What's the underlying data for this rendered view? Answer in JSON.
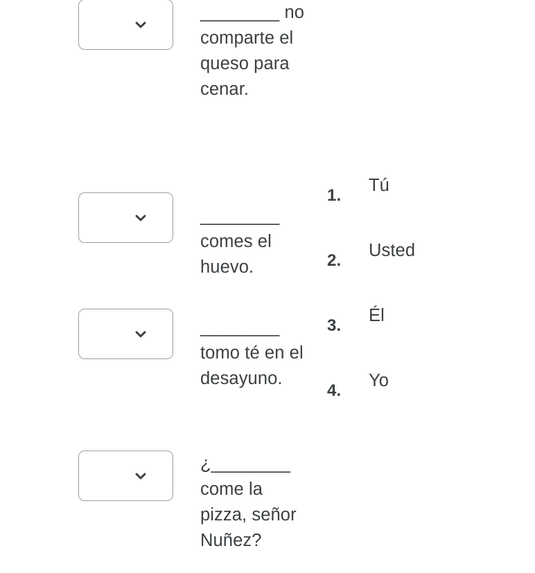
{
  "exercise": {
    "questions": [
      {
        "id": "q1",
        "select_name": "answer-select-1",
        "selected_value": "",
        "icon": "chevron-down-icon",
        "sentence": "________ no comparte el queso para cenar."
      },
      {
        "id": "q2",
        "select_name": "answer-select-2",
        "selected_value": "",
        "icon": "chevron-down-icon",
        "sentence": "________ comes el huevo."
      },
      {
        "id": "q3",
        "select_name": "answer-select-3",
        "selected_value": "",
        "icon": "chevron-down-icon",
        "sentence": "________ tomo té en el desayuno."
      },
      {
        "id": "q4",
        "select_name": "answer-select-4",
        "selected_value": "",
        "icon": "chevron-down-icon",
        "sentence": "¿________ come la pizza, señor Nuñez?"
      }
    ],
    "options": [
      {
        "number": "1.",
        "label": "Tú"
      },
      {
        "number": "2.",
        "label": "Usted"
      },
      {
        "number": "3.",
        "label": "Él"
      },
      {
        "number": "4.",
        "label": "Yo"
      }
    ],
    "colors": {
      "background": "#ffffff",
      "text": "#3c4043",
      "border": "#9aa0a6",
      "icon": "#3c4043"
    }
  }
}
